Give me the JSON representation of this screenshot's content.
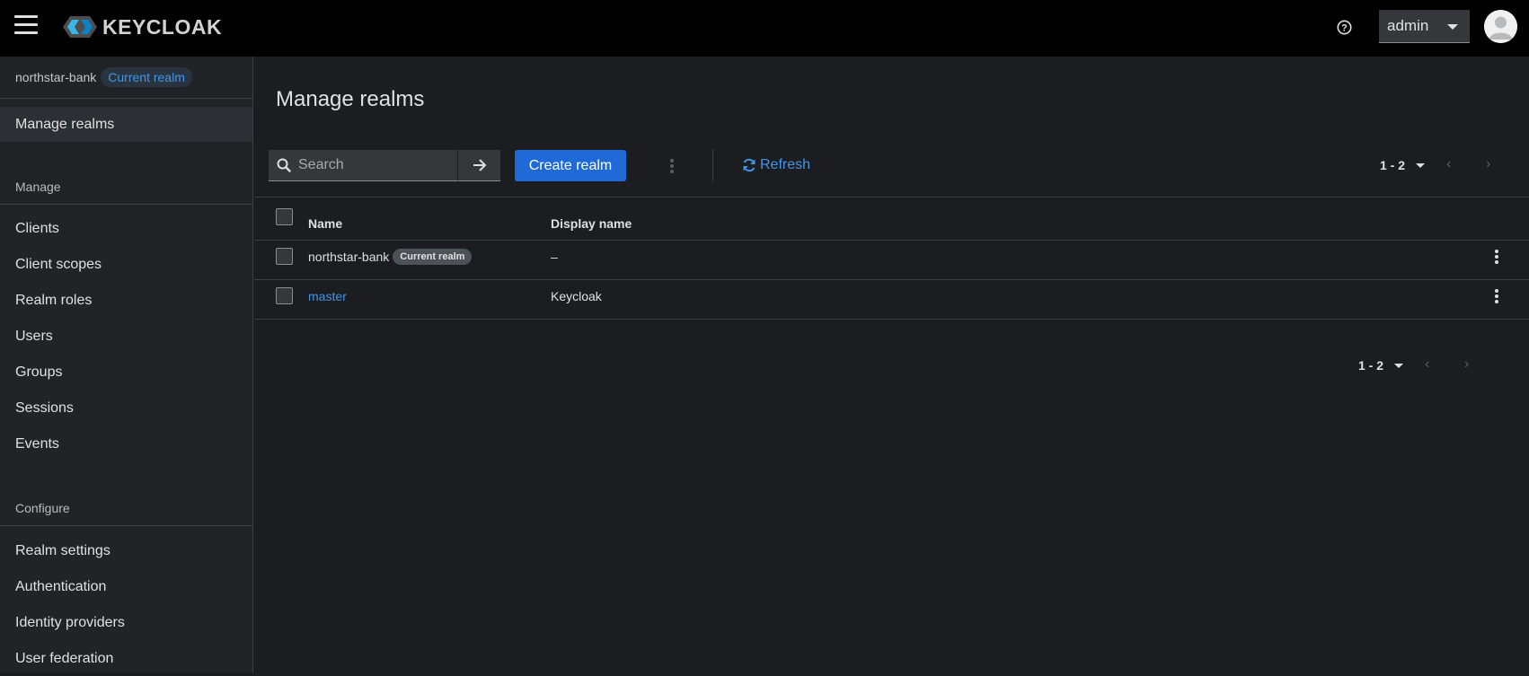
{
  "header": {
    "app_name": "KEYCLOAK",
    "user": "admin"
  },
  "sidebar": {
    "realm": {
      "name": "northstar-bank",
      "badge": "Current realm"
    },
    "manage_realms": "Manage realms",
    "manage_heading": "Manage",
    "manage_items": [
      "Clients",
      "Client scopes",
      "Realm roles",
      "Users",
      "Groups",
      "Sessions",
      "Events"
    ],
    "configure_heading": "Configure",
    "configure_items": [
      "Realm settings",
      "Authentication",
      "Identity providers",
      "User federation"
    ]
  },
  "main": {
    "title": "Manage realms",
    "search_placeholder": "Search",
    "create_label": "Create realm",
    "refresh_label": "Refresh",
    "pagination": "1 - 2",
    "columns": [
      "Name",
      "Display name"
    ],
    "rows": [
      {
        "name": "northstar-bank",
        "badge": "Current realm",
        "display_name": "–",
        "is_link": false
      },
      {
        "name": "master",
        "badge": "",
        "display_name": "Keycloak",
        "is_link": true
      }
    ]
  },
  "colors": {
    "accent": "#1f6ad6",
    "link": "#4394e5",
    "masthead": "#000000",
    "background": "#1b1d21",
    "sidebar": "#212427"
  },
  "icons": [
    "hamburger-icon",
    "keycloak-logo",
    "help-icon",
    "caret-down-icon",
    "avatar-icon",
    "search-icon",
    "arrow-right-icon",
    "kebab-icon",
    "refresh-icon",
    "chevron-left-icon",
    "chevron-right-icon"
  ]
}
